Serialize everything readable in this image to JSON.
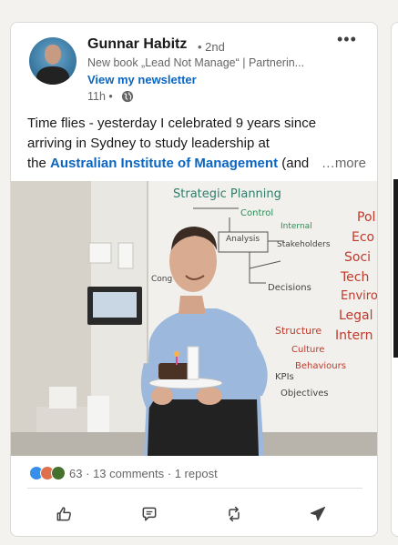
{
  "post": {
    "author": {
      "name": "Gunnar Habitz",
      "degree": "• 2nd",
      "headline": "New book „Lead Not Manage“ | Partnerin...",
      "newsletter_link": "View my newsletter",
      "time": "11h •",
      "visibility_icon": "globe-icon"
    },
    "menu_icon": "more-horizontal-icon",
    "menu_glyph": "•••",
    "text": {
      "line1": "Time flies - yesterday I celebrated 9 years since",
      "line2": "arriving in Sydney to study leadership at",
      "line3_prefix": "the ",
      "mention": "Australian Institute of Management",
      "line3_suffix": " (and",
      "see_more": "…more"
    },
    "image": {
      "whiteboard_texts": [
        "Strategic Planning",
        "Control",
        "Analysis",
        "Stakeholders",
        "Internal",
        "Decisions",
        "Structure",
        "Culture",
        "Behaviours",
        "KPIs",
        "Objectives",
        "Pol",
        "Eco",
        "Soci",
        "Tech",
        "Enviro",
        "Legal",
        "Intern",
        "Cong"
      ]
    },
    "social": {
      "reactions": [
        "like",
        "love",
        "celebrate"
      ],
      "reaction_count": "63",
      "comments": "13 comments",
      "reposts": "1 repost",
      "separator": "·"
    },
    "actions": [
      {
        "name": "like",
        "icon": "thumbs-up-icon"
      },
      {
        "name": "comment",
        "icon": "comment-icon"
      },
      {
        "name": "repost",
        "icon": "repost-icon"
      },
      {
        "name": "send",
        "icon": "send-icon"
      }
    ]
  },
  "colors": {
    "link": "#0a66c2",
    "secondary_text": "#666666",
    "marker_red": "#c0392b",
    "marker_green": "#2e8b57"
  }
}
